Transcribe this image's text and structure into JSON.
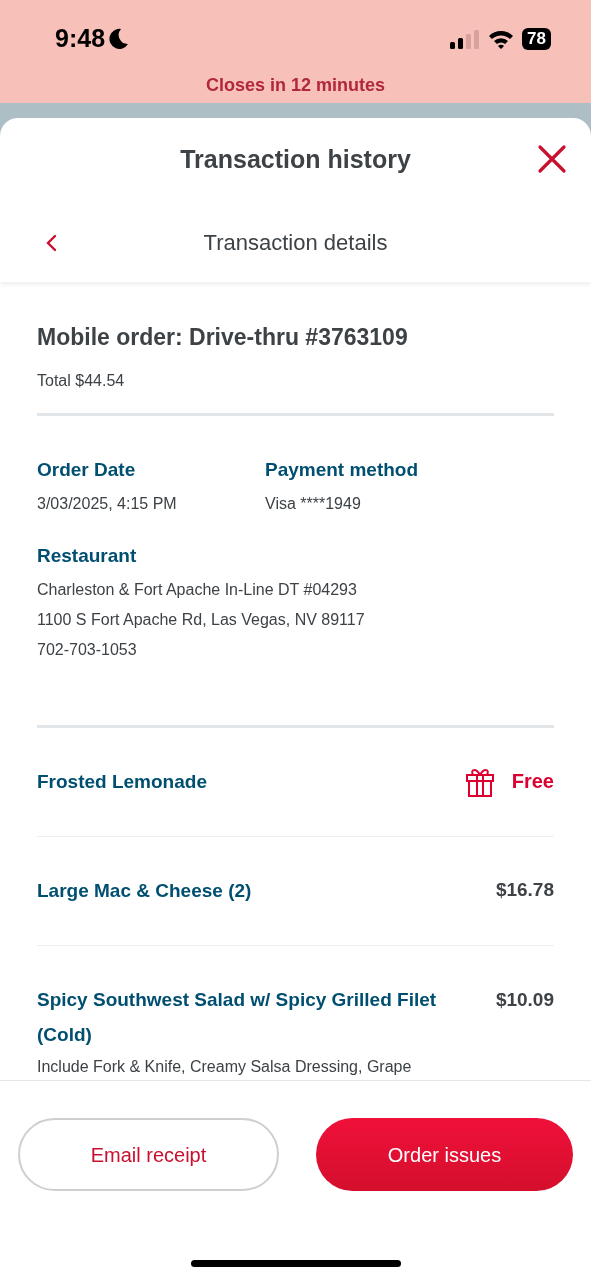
{
  "status_bar": {
    "time": "9:48",
    "battery": "78"
  },
  "banner": {
    "text": "Closes in 12 minutes"
  },
  "sheet": {
    "title": "Transaction history",
    "subtitle": "Transaction details"
  },
  "order": {
    "title": "Mobile order: Drive-thru #3763109",
    "total": "Total $44.54",
    "fields": [
      {
        "label": "Order Date",
        "value": "3/03/2025, 4:15 PM"
      },
      {
        "label": "Payment method",
        "value": "Visa ****1949"
      }
    ],
    "restaurant": {
      "label": "Restaurant",
      "lines": [
        "Charleston & Fort Apache In-Line DT #04293",
        "1100 S Fort Apache Rd, Las Vegas, NV 89117",
        "702-703-1053"
      ]
    }
  },
  "items": [
    {
      "kind": "reward",
      "name": "Frosted Lemonade",
      "price": "Free"
    },
    {
      "kind": "priced",
      "name": "Large Mac & Cheese (2)",
      "price": "$16.78"
    },
    {
      "kind": "priced",
      "name": "Spicy Southwest Salad w/ Spicy Grilled Filet (Cold)",
      "price": "$10.09",
      "description": "Include Fork & Knife, Creamy Salsa Dressing, Grape"
    }
  ],
  "buttons": [
    {
      "kind": "outline",
      "label": "Email receipt"
    },
    {
      "kind": "primary",
      "label": "Order issues"
    }
  ]
}
